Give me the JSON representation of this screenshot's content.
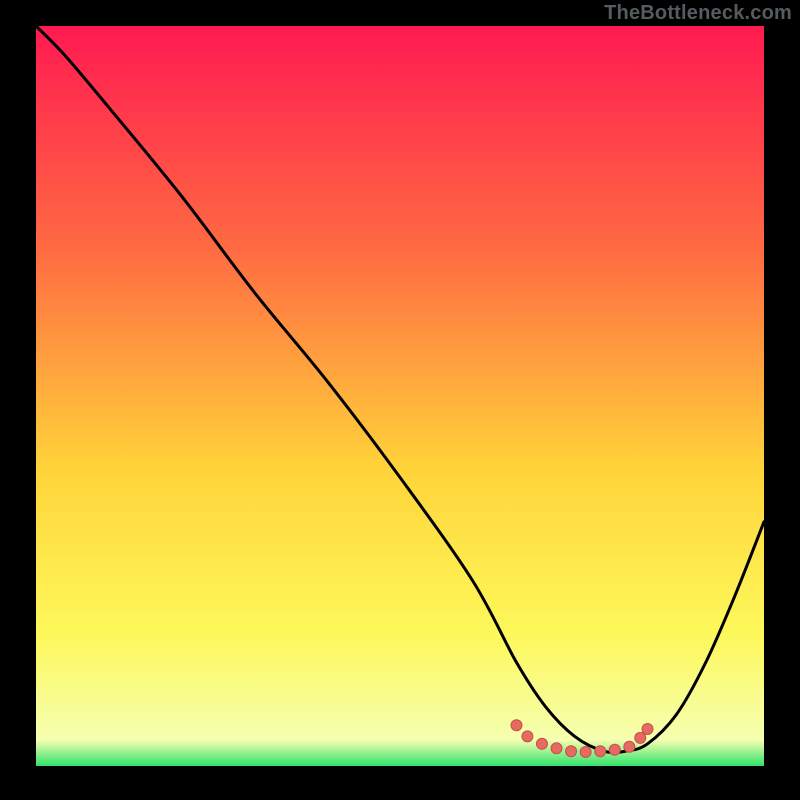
{
  "watermark": "TheBottleneck.com",
  "colors": {
    "bg_black": "#000000",
    "grad_top": "#ff1a51",
    "grad_mid1": "#ff6a42",
    "grad_mid2": "#ffd43a",
    "grad_mid3": "#fdf85a",
    "grad_bot": "#2fe26a",
    "curve": "#000000",
    "dot_fill": "#e46a62",
    "dot_stroke": "#c94e46"
  },
  "chart_data": {
    "type": "line",
    "title": "",
    "xlabel": "",
    "ylabel": "",
    "xlim": [
      0,
      100
    ],
    "ylim": [
      0,
      100
    ],
    "series": [
      {
        "name": "curve",
        "x": [
          0,
          4,
          10,
          20,
          30,
          40,
          50,
          60,
          66,
          70,
          74,
          78,
          81,
          84,
          88,
          92,
          96,
          100
        ],
        "y": [
          100,
          96,
          89,
          77,
          64,
          52,
          39,
          25,
          14,
          8,
          4,
          2,
          2,
          3,
          7,
          14,
          23,
          33
        ]
      }
    ],
    "markers": {
      "name": "highlight-dots",
      "points": [
        {
          "x": 66,
          "y": 5.5
        },
        {
          "x": 67.5,
          "y": 4.0
        },
        {
          "x": 69.5,
          "y": 3.0
        },
        {
          "x": 71.5,
          "y": 2.4
        },
        {
          "x": 73.5,
          "y": 2.0
        },
        {
          "x": 75.5,
          "y": 1.9
        },
        {
          "x": 77.5,
          "y": 2.0
        },
        {
          "x": 79.5,
          "y": 2.2
        },
        {
          "x": 81.5,
          "y": 2.6
        },
        {
          "x": 83.0,
          "y": 3.8
        },
        {
          "x": 84.0,
          "y": 5.0
        }
      ]
    },
    "gradient_stops": [
      {
        "offset": 0.0,
        "color": "#ff1a51"
      },
      {
        "offset": 0.3,
        "color": "#ff6a42"
      },
      {
        "offset": 0.6,
        "color": "#ffd43a"
      },
      {
        "offset": 0.82,
        "color": "#fdf85a"
      },
      {
        "offset": 0.965,
        "color": "#f5ffb0"
      },
      {
        "offset": 1.0,
        "color": "#2fe26a"
      }
    ]
  }
}
